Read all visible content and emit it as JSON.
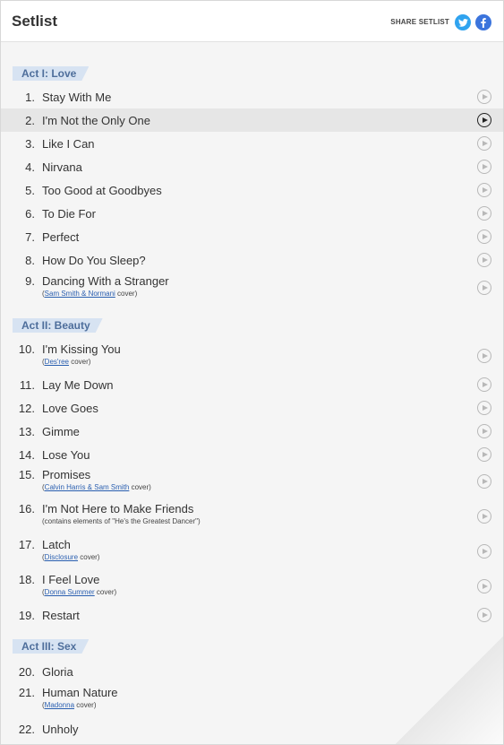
{
  "header": {
    "title": "Setlist",
    "share_label": "SHARE SETLIST",
    "twitter_icon": "twitter-icon",
    "facebook_icon": "facebook-icon"
  },
  "acts": [
    {
      "label": "Act I: Love"
    },
    {
      "label": "Act II: Beauty"
    },
    {
      "label": "Act III: Sex"
    }
  ],
  "songs": [
    {
      "num": "1.",
      "title": "Stay With Me"
    },
    {
      "num": "2.",
      "title": "I'm Not the Only One",
      "active": true
    },
    {
      "num": "3.",
      "title": "Like I Can"
    },
    {
      "num": "4.",
      "title": "Nirvana"
    },
    {
      "num": "5.",
      "title": "Too Good at Goodbyes"
    },
    {
      "num": "6.",
      "title": "To Die For"
    },
    {
      "num": "7.",
      "title": "Perfect"
    },
    {
      "num": "8.",
      "title": "How Do You Sleep?"
    },
    {
      "num": "9.",
      "title": "Dancing With a Stranger",
      "note_open": "(",
      "note_link": "Sam Smith & Normani",
      "note_close": " cover)"
    },
    {
      "num": "10.",
      "title": "I'm Kissing You",
      "note_open": "(",
      "note_link": "Des'ree",
      "note_close": " cover)"
    },
    {
      "num": "11.",
      "title": "Lay Me Down"
    },
    {
      "num": "12.",
      "title": "Love Goes"
    },
    {
      "num": "13.",
      "title": "Gimme"
    },
    {
      "num": "14.",
      "title": "Lose You"
    },
    {
      "num": "15.",
      "title": "Promises",
      "note_open": "(",
      "note_link": "Calvin Harris & Sam Smith",
      "note_close": " cover)"
    },
    {
      "num": "16.",
      "title": "I'm Not Here to Make Friends",
      "note_text": "(contains elements of \"He's the Greatest Dancer\")"
    },
    {
      "num": "17.",
      "title": "Latch",
      "note_open": "(",
      "note_link": "Disclosure",
      "note_close": " cover)"
    },
    {
      "num": "18.",
      "title": "I Feel Love",
      "note_open": "(",
      "note_link": "Donna Summer",
      "note_close": " cover)"
    },
    {
      "num": "19.",
      "title": "Restart"
    },
    {
      "num": "20.",
      "title": "Gloria"
    },
    {
      "num": "21.",
      "title": "Human Nature",
      "note_open": "(",
      "note_link": "Madonna",
      "note_close": " cover)"
    },
    {
      "num": "22.",
      "title": "Unholy"
    }
  ],
  "colors": {
    "act_bg": "#d7e3f2",
    "act_text": "#4e6e9b",
    "link": "#2a5fb0",
    "active_row": "#e6e6e6"
  }
}
